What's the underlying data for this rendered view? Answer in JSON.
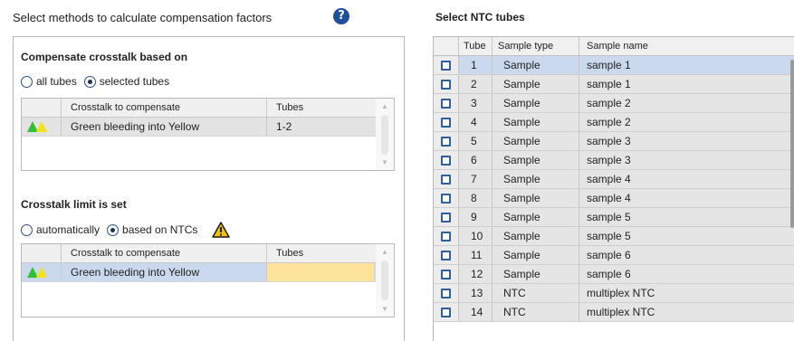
{
  "left": {
    "title": "Select methods to calculate compensation factors",
    "help_icon": "help-icon",
    "crosstalk_section": {
      "title": "Compensate crosstalk based on",
      "options": [
        {
          "label": "all tubes",
          "checked": false
        },
        {
          "label": "selected tubes",
          "checked": true
        }
      ],
      "table": {
        "headers": [
          "",
          "Crosstalk to compensate",
          "Tubes"
        ],
        "rows": [
          {
            "crosstalk": "Green bleeding into Yellow",
            "tubes": "1-2"
          }
        ]
      }
    },
    "limit_section": {
      "title": "Crosstalk limit is set",
      "options": [
        {
          "label": "automatically",
          "checked": false
        },
        {
          "label": "based on NTCs",
          "checked": true
        }
      ],
      "warning_icon": "warning-icon",
      "table": {
        "headers": [
          "",
          "Crosstalk to compensate",
          "Tubes"
        ],
        "rows": [
          {
            "crosstalk": "Green bleeding into Yellow",
            "tubes": ""
          }
        ]
      }
    }
  },
  "right": {
    "title": "Select NTC tubes",
    "headers": [
      "",
      "Tube",
      "Sample type",
      "Sample name"
    ],
    "rows": [
      {
        "tube": "1",
        "type": "Sample",
        "name": "sample 1"
      },
      {
        "tube": "2",
        "type": "Sample",
        "name": "sample 1"
      },
      {
        "tube": "3",
        "type": "Sample",
        "name": "sample 2"
      },
      {
        "tube": "4",
        "type": "Sample",
        "name": "sample 2"
      },
      {
        "tube": "5",
        "type": "Sample",
        "name": "sample 3"
      },
      {
        "tube": "6",
        "type": "Sample",
        "name": "sample 3"
      },
      {
        "tube": "7",
        "type": "Sample",
        "name": "sample 4"
      },
      {
        "tube": "8",
        "type": "Sample",
        "name": "sample 4"
      },
      {
        "tube": "9",
        "type": "Sample",
        "name": "sample 5"
      },
      {
        "tube": "10",
        "type": "Sample",
        "name": "sample 5"
      },
      {
        "tube": "11",
        "type": "Sample",
        "name": "sample 6"
      },
      {
        "tube": "12",
        "type": "Sample",
        "name": "sample 6"
      },
      {
        "tube": "13",
        "type": "NTC",
        "name": "multiplex NTC"
      },
      {
        "tube": "14",
        "type": "NTC",
        "name": "multiplex NTC"
      }
    ]
  },
  "colors": {
    "selected_row": "#cbd9ef",
    "row": "#e5e5e5",
    "highlight_cell": "#fde49a",
    "green": "#2fc22f",
    "yellow": "#f3e21b",
    "checkbox_border": "#2f5f9f"
  }
}
